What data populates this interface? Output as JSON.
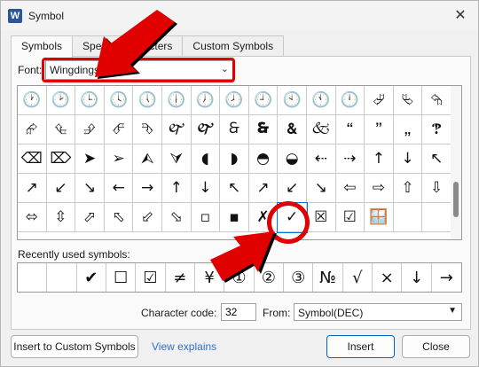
{
  "window": {
    "app_icon": "W",
    "title": "Symbol",
    "close_glyph": "✕"
  },
  "tabs": [
    {
      "label": "Symbols"
    },
    {
      "label": "Special Characters"
    },
    {
      "label": "Custom Symbols"
    }
  ],
  "font": {
    "label": "Font:",
    "value": "Wingdings",
    "chevron": "⌄"
  },
  "grid": {
    "symbols": [
      "🕐",
      "🕑",
      "🕒",
      "🕓",
      "🕔",
      "🕕",
      "🕖",
      "🕗",
      "🕘",
      "🕙",
      "🕚",
      "🕛",
      "⮰",
      "⮱",
      "⮲",
      "⮳",
      "⮴",
      "⮵",
      "⮶",
      "⮷",
      "🙰",
      "🙱",
      "🙲",
      "🙳",
      "🙴",
      "🙵",
      "🙶",
      "🙷",
      "🙸",
      "🙹",
      "⌫",
      "⌦",
      "➤",
      "➢",
      "⮙",
      "⮛",
      "◖",
      "◗",
      "◓",
      "◒",
      "⇠",
      "⇢",
      "↑",
      "↓",
      "↖",
      "↗",
      "↙",
      "↘",
      "←",
      "→",
      "↑",
      "↓",
      "↖",
      "↗",
      "↙",
      "↘",
      "⇦",
      "⇨",
      "⇧",
      "⇩",
      "⬄",
      "⇳",
      "⬀",
      "⬁",
      "⬃",
      "⬂",
      "▫",
      "▪",
      "✗",
      "✓",
      "☒",
      "☑",
      "🪟",
      "",
      ""
    ],
    "selected_index": 69
  },
  "recent": {
    "label": "Recently used symbols:",
    "symbols": [
      "",
      "",
      "✔",
      "☐",
      "☑",
      "≠",
      "¥",
      "①",
      "②",
      "③",
      "№",
      "√",
      "×",
      "↓",
      "→"
    ]
  },
  "char_code": {
    "label": "Character code:",
    "value": "32"
  },
  "from": {
    "label": "From:",
    "value": "Symbol(DEC)",
    "caret": "▼"
  },
  "buttons": {
    "custom": "Insert to Custom Symbols",
    "view_explains": "View explains",
    "insert": "Insert",
    "close": "Close"
  },
  "colors": {
    "annotation": "#e00000",
    "accent": "#0067c0",
    "link": "#2f6fd0"
  }
}
